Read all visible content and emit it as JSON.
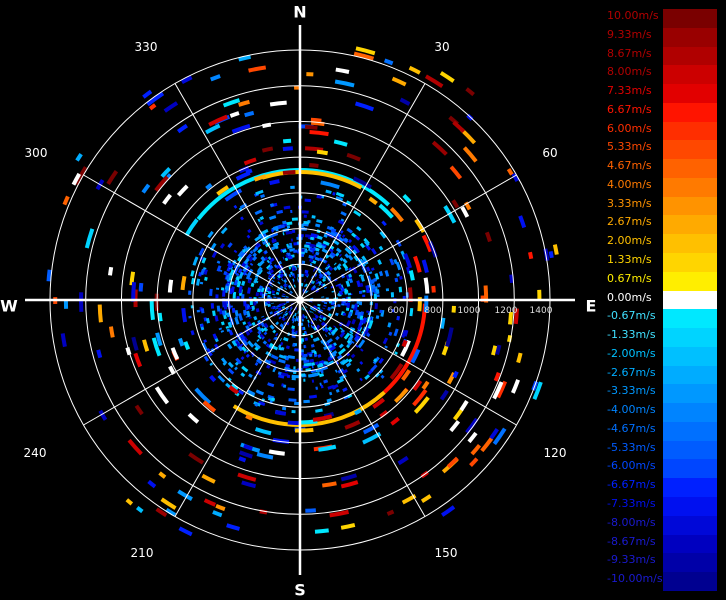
{
  "display": {
    "cardinals": {
      "north": "N",
      "south": "S",
      "east": "E",
      "west": "W"
    },
    "azimuth_labels": [
      "30",
      "60",
      "120",
      "150",
      "210",
      "240",
      "300",
      "330"
    ],
    "range_labels": [
      "600",
      "800",
      "1000",
      "1200",
      "1400"
    ],
    "max_range": 1400,
    "ring_step": 200
  },
  "legend": {
    "items": [
      {
        "label": "10.00m/s",
        "color": "#7a0000"
      },
      {
        "label": "9.33m/s",
        "color": "#990000"
      },
      {
        "label": "8.67m/s",
        "color": "#b00000"
      },
      {
        "label": "8.00m/s",
        "color": "#cc0000"
      },
      {
        "label": "7.33m/s",
        "color": "#e20000"
      },
      {
        "label": "6.67m/s",
        "color": "#ff1400"
      },
      {
        "label": "6.00m/s",
        "color": "#ff2e00"
      },
      {
        "label": "5.33m/s",
        "color": "#ff4800"
      },
      {
        "label": "4.67m/s",
        "color": "#ff6200"
      },
      {
        "label": "4.00m/s",
        "color": "#ff7a00"
      },
      {
        "label": "3.33m/s",
        "color": "#ff9300"
      },
      {
        "label": "2.67m/s",
        "color": "#ffaa00"
      },
      {
        "label": "2.00m/s",
        "color": "#ffc000"
      },
      {
        "label": "1.33m/s",
        "color": "#ffd500"
      },
      {
        "label": "0.67m/s",
        "color": "#ffee00"
      },
      {
        "label": "0.00m/s",
        "color": "#ffffff"
      },
      {
        "label": "-0.67m/s",
        "color": "#00e8ff"
      },
      {
        "label": "-1.33m/s",
        "color": "#00d4ff"
      },
      {
        "label": "-2.00m/s",
        "color": "#00c0ff"
      },
      {
        "label": "-2.67m/s",
        "color": "#00acff"
      },
      {
        "label": "-3.33m/s",
        "color": "#0098ff"
      },
      {
        "label": "-4.00m/s",
        "color": "#0084ff"
      },
      {
        "label": "-4.67m/s",
        "color": "#0070ff"
      },
      {
        "label": "-5.33m/s",
        "color": "#005cff"
      },
      {
        "label": "-6.00m/s",
        "color": "#0046ff"
      },
      {
        "label": "-6.67m/s",
        "color": "#0020ff"
      },
      {
        "label": "-7.33m/s",
        "color": "#0010f0"
      },
      {
        "label": "-8.00m/s",
        "color": "#0008d8"
      },
      {
        "label": "-8.67m/s",
        "color": "#0000c0"
      },
      {
        "label": "-9.33m/s",
        "color": "#0000a8"
      },
      {
        "label": "-10.00m/s",
        "color": "#000090"
      }
    ]
  }
}
